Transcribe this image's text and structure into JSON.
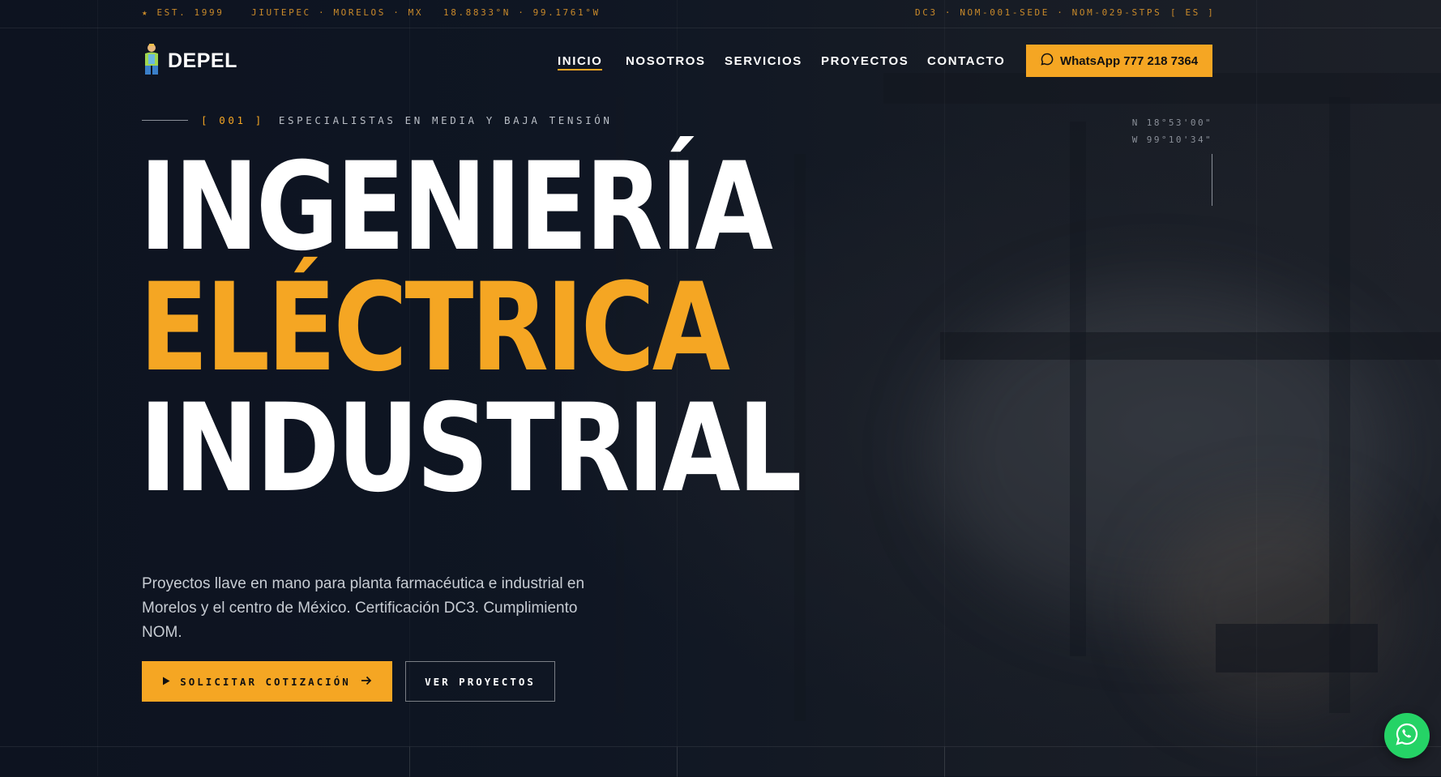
{
  "topbar": {
    "est": "★ EST. 1999",
    "location": "JIUTEPEC · MORELOS · MX",
    "gps": "18.8833°N · 99.1761°W",
    "certs": "DC3 · NOM-001-SEDE · NOM-029-STPS",
    "lang": "[ ES ]"
  },
  "nav": {
    "brand": "DEPEL",
    "items": [
      {
        "label": "INICIO",
        "active": true
      },
      {
        "label": "NOSOTROS"
      },
      {
        "label": "SERVICIOS"
      },
      {
        "label": "PROYECTOS"
      },
      {
        "label": "CONTACTO"
      }
    ],
    "whatsapp_label": "WhatsApp 777 218 7364"
  },
  "hero": {
    "eyebrow_num": "[ 001 ]",
    "eyebrow_text": "ESPECIALISTAS EN MEDIA Y BAJA TENSIÓN",
    "coord_n": "N 18°53'00\"",
    "coord_w": "W 99°10'34\"",
    "line1": "INGENIERÍA",
    "line2": "ELÉCTRICA",
    "line3": "INDUSTRIAL",
    "lead": "Proyectos llave en mano para planta farmacéutica e industrial en Morelos y el centro de México. Certificación DC3. Cumplimiento NOM.",
    "cta_primary": "SOLICITAR COTIZACIÓN",
    "cta_secondary": "VER PROYECTOS"
  },
  "colors": {
    "accent": "#f5a623",
    "background": "#0e1420",
    "whatsapp": "#25d366"
  },
  "icons": {
    "logo": "worker-logo-icon",
    "whatsapp": "chat-bubble-icon",
    "play": "play-icon",
    "arrow": "arrow-right-icon",
    "floating": "whatsapp-icon"
  }
}
